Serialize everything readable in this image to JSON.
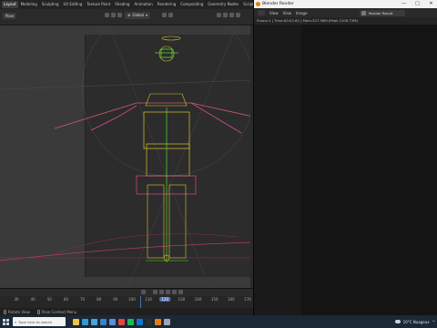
{
  "blender": {
    "workspace_tabs": [
      "Layout",
      "Modeling",
      "Sculpting",
      "UV Editing",
      "Texture Paint",
      "Shading",
      "Animation",
      "Rendering",
      "Compositing",
      "Geometry Nodes",
      "Scripting"
    ],
    "active_tab": "Layout",
    "mode": "Pose",
    "transform_orientation": "Global"
  },
  "timeline": {
    "ticks": [
      "30",
      "40",
      "50",
      "60",
      "70",
      "80",
      "90",
      "100",
      "110",
      "120",
      "130",
      "140",
      "150",
      "160",
      "170"
    ],
    "current_frame": "120"
  },
  "status_bar": {
    "rotate_view": "Rotate View",
    "context_menu": "Pose Context Menu"
  },
  "render_window": {
    "title": "Blender Render",
    "menus": [
      "View",
      "View",
      "Image"
    ],
    "slot_label": "Render Result",
    "stats": "Frame:1 | Time:00:02.62 | Mem:327.56M (Peak 2109.73M)",
    "window_buttons": [
      "—",
      "□",
      "✕"
    ]
  },
  "taskbar": {
    "search_placeholder": "Type here to search",
    "weather": "10°C Nuageux",
    "apps": [
      {
        "name": "file-explorer",
        "color": "#f0c24a"
      },
      {
        "name": "edge",
        "color": "#2f9bd6"
      },
      {
        "name": "store",
        "color": "#4aa3df"
      },
      {
        "name": "mail",
        "color": "#3b82c4"
      },
      {
        "name": "photos",
        "color": "#5b8fd6"
      },
      {
        "name": "chrome",
        "color": "#e5453a"
      },
      {
        "name": "spotify",
        "color": "#1db954"
      },
      {
        "name": "outlook",
        "color": "#1a73c9"
      },
      {
        "name": "terminal",
        "color": "#2d2d2d"
      },
      {
        "name": "blender",
        "color": "#e87d0d"
      },
      {
        "name": "app-3d",
        "color": "#9aa7b4"
      }
    ]
  },
  "colors": {
    "accent": "#4772b3",
    "armature_selected": "#55dd33",
    "bone_yellow": "#d9c62a",
    "bone_pink": "#d64b8c",
    "blender_orange": "#e87d0d"
  }
}
